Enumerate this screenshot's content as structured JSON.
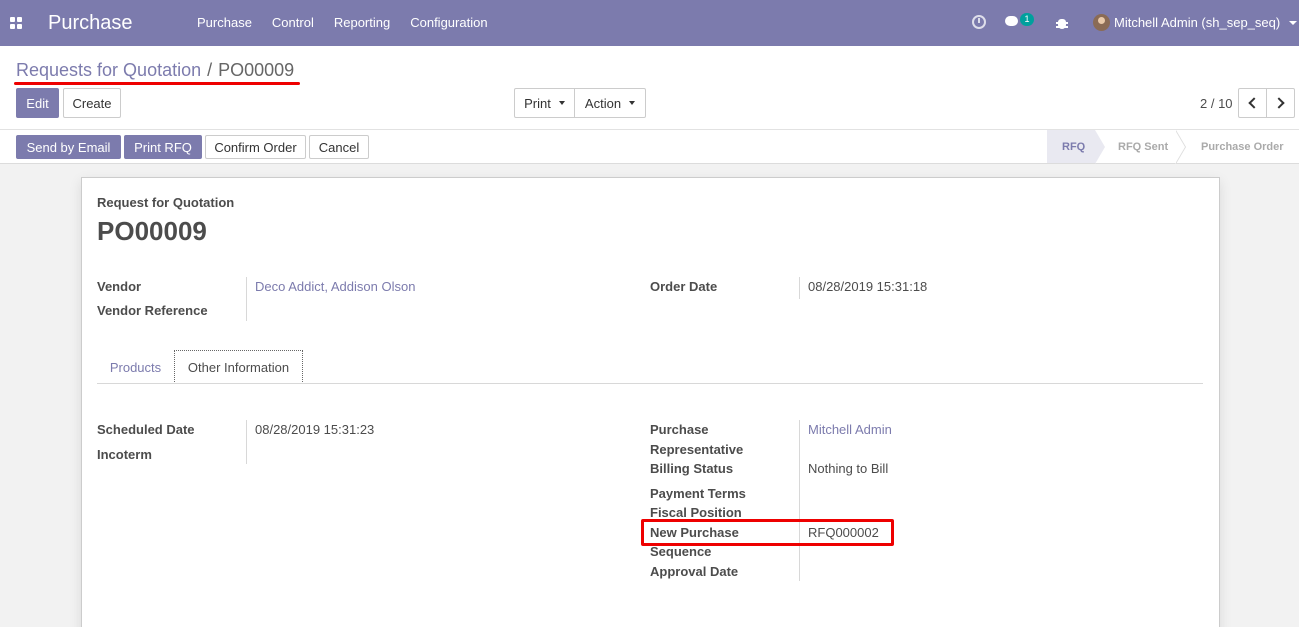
{
  "navbar": {
    "brand": "Purchase",
    "menu": [
      "Purchase",
      "Control",
      "Reporting",
      "Configuration"
    ],
    "chat_badge": "1",
    "user": "Mitchell Admin (sh_sep_seq)",
    "color": "#7c7bad"
  },
  "breadcrumb": {
    "parent": "Requests for Quotation",
    "separator": "/",
    "current": "PO00009"
  },
  "toolbar": {
    "edit": "Edit",
    "create": "Create",
    "print": "Print",
    "action": "Action",
    "pager": "2 / 10"
  },
  "statusbar": {
    "send_email": "Send by Email",
    "print_rfq": "Print RFQ",
    "confirm": "Confirm Order",
    "cancel": "Cancel",
    "stages": [
      "RFQ",
      "RFQ Sent",
      "Purchase Order"
    ],
    "active_stage": "RFQ"
  },
  "form": {
    "doc_type": "Request for Quotation",
    "name": "PO00009",
    "vendor_label": "Vendor",
    "vendor_value": "Deco Addict, Addison Olson",
    "vendor_ref_label": "Vendor Reference",
    "order_date_label": "Order Date",
    "order_date_value": "08/28/2019 15:31:18",
    "tabs": [
      "Products",
      "Other Information"
    ],
    "active_tab": "Other Information",
    "scheduled_date_label": "Scheduled Date",
    "scheduled_date_value": "08/28/2019 15:31:23",
    "incoterm_label": "Incoterm",
    "purchase_rep_label_1": "Purchase",
    "purchase_rep_label_2": "Representative",
    "purchase_rep_value": "Mitchell Admin",
    "billing_status_label": "Billing Status",
    "billing_status_value": "Nothing to Bill",
    "payment_terms_label": "Payment Terms",
    "fiscal_position_label": "Fiscal Position",
    "new_purchase_seq_label_1": "New Purchase",
    "new_purchase_seq_label_2": "Sequence",
    "new_purchase_seq_value": "RFQ000002",
    "approval_date_label": "Approval Date"
  }
}
